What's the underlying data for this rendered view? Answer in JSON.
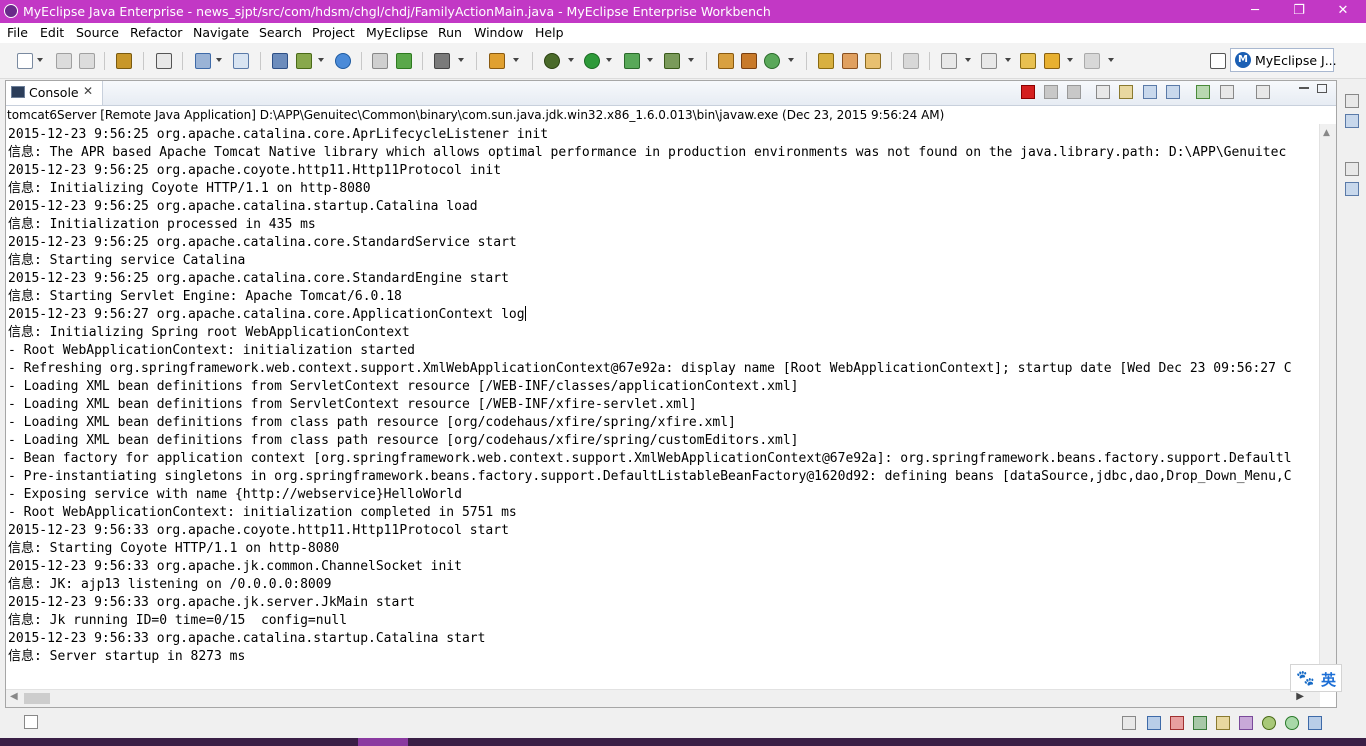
{
  "window": {
    "title": "MyEclipse Java Enterprise - news_sjpt/src/com/hdsm/chgl/chdj/FamilyActionMain.java - MyEclipse Enterprise Workbench",
    "min_symbol": "─",
    "restore_symbol": "❐",
    "close_symbol": "✕"
  },
  "menu": [
    "File",
    "Edit",
    "Source",
    "Refactor",
    "Navigate",
    "Search",
    "Project",
    "MyEclipse",
    "Run",
    "Window",
    "Help"
  ],
  "perspective": {
    "icon_letter": "M",
    "label": "MyEclipse J..."
  },
  "console": {
    "tab_label": "Console",
    "tab_close": "✕",
    "process": "tomcat6Server [Remote Java Application] D:\\APP\\Genuitec\\Common\\binary\\com.sun.java.jdk.win32.x86_1.6.0.013\\bin\\javaw.exe (Dec 23, 2015 9:56:24 AM)",
    "lines": [
      "2015-12-23 9:56:25 org.apache.catalina.core.AprLifecycleListener init",
      "信息: The APR based Apache Tomcat Native library which allows optimal performance in production environments was not found on the java.library.path: D:\\APP\\Genuitec",
      "2015-12-23 9:56:25 org.apache.coyote.http11.Http11Protocol init",
      "信息: Initializing Coyote HTTP/1.1 on http-8080",
      "2015-12-23 9:56:25 org.apache.catalina.startup.Catalina load",
      "信息: Initialization processed in 435 ms",
      "2015-12-23 9:56:25 org.apache.catalina.core.StandardService start",
      "信息: Starting service Catalina",
      "2015-12-23 9:56:25 org.apache.catalina.core.StandardEngine start",
      "信息: Starting Servlet Engine: Apache Tomcat/6.0.18",
      "2015-12-23 9:56:27 org.apache.catalina.core.ApplicationContext log",
      "信息: Initializing Spring root WebApplicationContext",
      "- Root WebApplicationContext: initialization started",
      "- Refreshing org.springframework.web.context.support.XmlWebApplicationContext@67e92a: display name [Root WebApplicationContext]; startup date [Wed Dec 23 09:56:27 C",
      "- Loading XML bean definitions from ServletContext resource [/WEB-INF/classes/applicationContext.xml]",
      "- Loading XML bean definitions from ServletContext resource [/WEB-INF/xfire-servlet.xml]",
      "- Loading XML bean definitions from class path resource [org/codehaus/xfire/spring/xfire.xml]",
      "- Loading XML bean definitions from class path resource [org/codehaus/xfire/spring/customEditors.xml]",
      "- Bean factory for application context [org.springframework.web.context.support.XmlWebApplicationContext@67e92a]: org.springframework.beans.factory.support.Defaultl",
      "- Pre-instantiating singletons in org.springframework.beans.factory.support.DefaultListableBeanFactory@1620d92: defining beans [dataSource,jdbc,dao,Drop_Down_Menu,C",
      "- Exposing service with name {http://webservice}HelloWorld",
      "- Root WebApplicationContext: initialization completed in 5751 ms",
      "2015-12-23 9:56:33 org.apache.coyote.http11.Http11Protocol start",
      "信息: Starting Coyote HTTP/1.1 on http-8080",
      "2015-12-23 9:56:33 org.apache.jk.common.ChannelSocket init",
      "信息: JK: ajp13 listening on /0.0.0.0:8009",
      "2015-12-23 9:56:33 org.apache.jk.server.JkMain start",
      "信息: Jk running ID=0 time=0/15  config=null",
      "2015-12-23 9:56:33 org.apache.catalina.startup.Catalina start",
      "信息: Server startup in 8273 ms"
    ]
  },
  "ime": {
    "paw": "🐾",
    "label": "英"
  },
  "colors": {
    "titlebar": "#c238c5",
    "terminate": "#d42020"
  }
}
